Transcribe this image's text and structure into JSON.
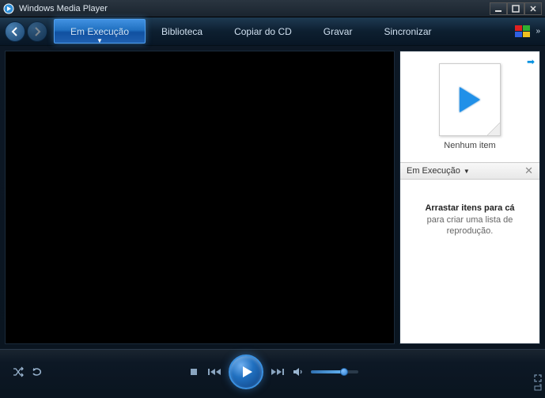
{
  "app": {
    "title": "Windows Media Player"
  },
  "tabs": {
    "now_playing": "Em Execução",
    "library": "Biblioteca",
    "rip": "Copiar do CD",
    "burn": "Gravar",
    "sync": "Sincronizar"
  },
  "sidebar": {
    "thumb_label": "Nenhum item",
    "list_title": "Em Execução",
    "empty_bold": "Arrastar itens para cá",
    "empty_sub": "para criar uma lista de reprodução."
  }
}
